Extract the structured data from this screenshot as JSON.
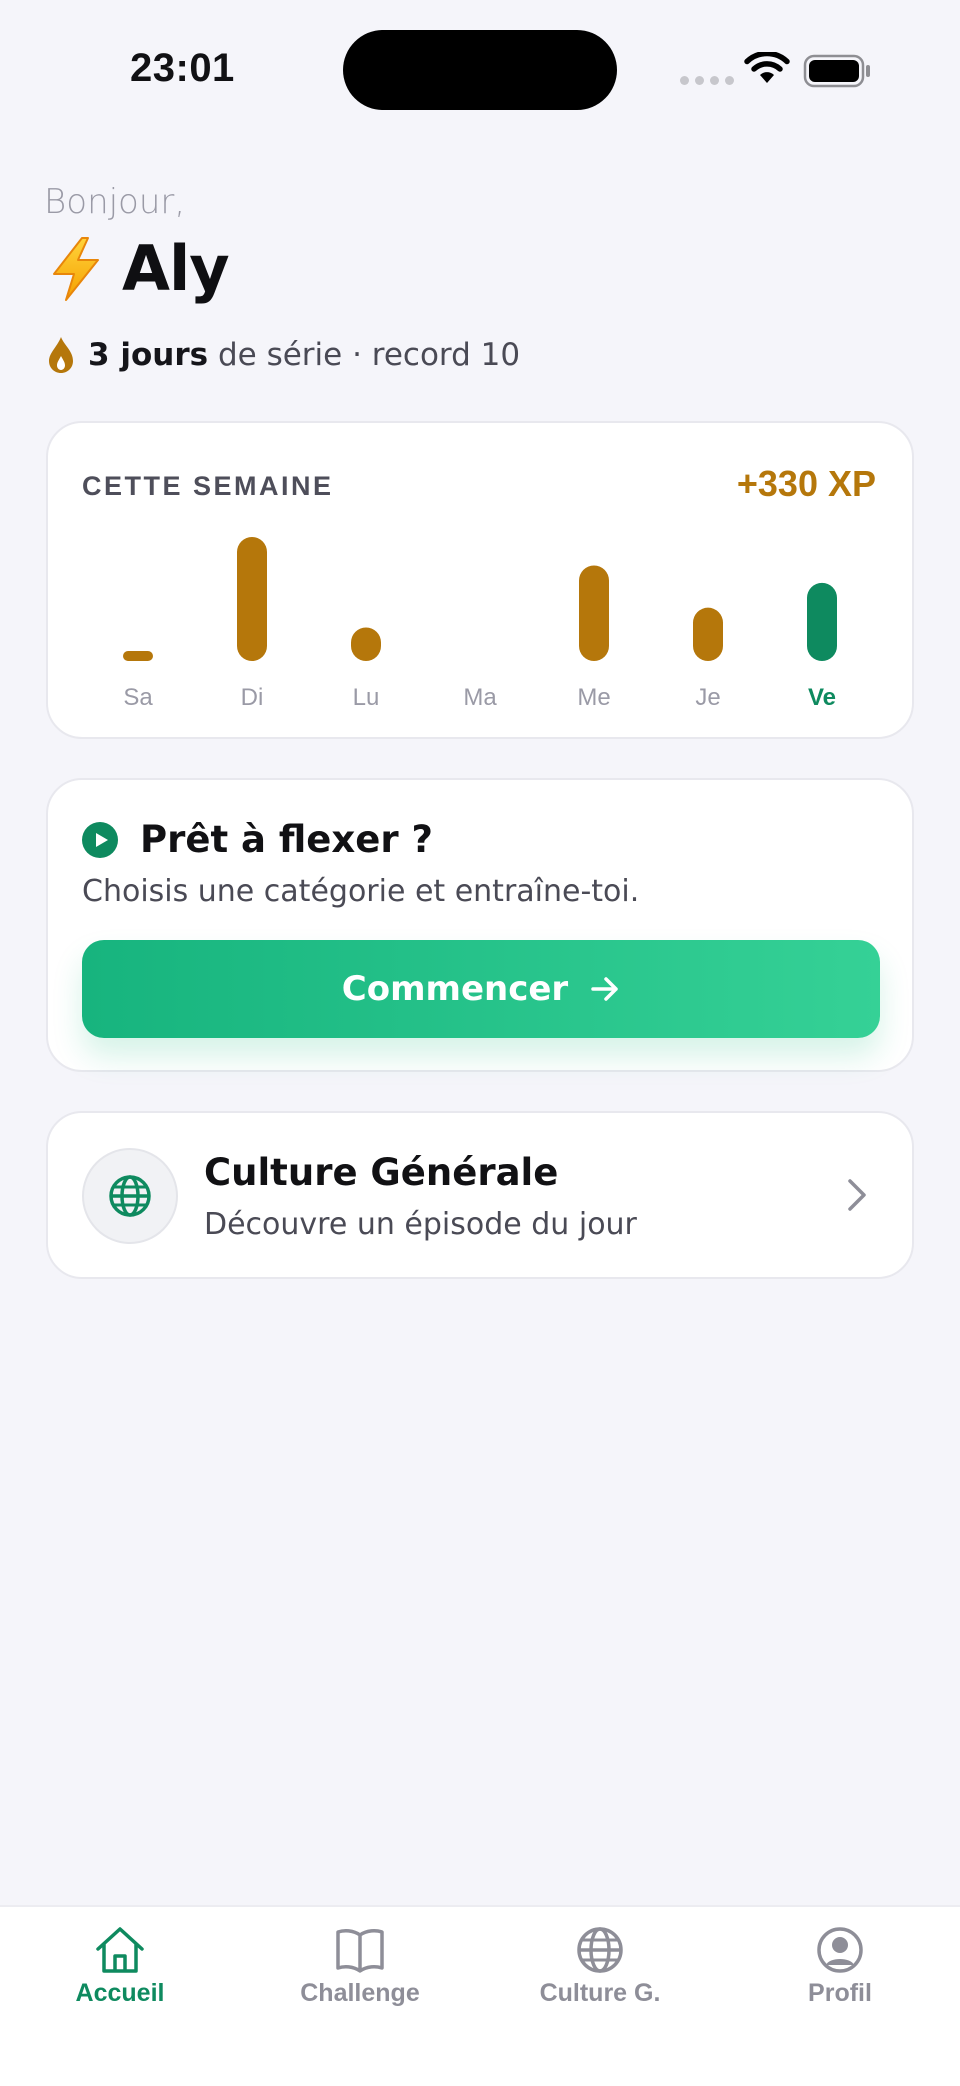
{
  "status_bar": {
    "time": "23:01"
  },
  "greeting": "Bonjour,",
  "user": {
    "emoji": "⚡",
    "name": "Aly"
  },
  "streak": {
    "strong": "3 jours",
    "rest": " de série · record 10"
  },
  "week": {
    "title": "CETTE SEMAINE",
    "xp": "+330 XP",
    "days": [
      {
        "label": "Sa",
        "level": 0.08
      },
      {
        "label": "Di",
        "level": 1.0
      },
      {
        "label": "Lu",
        "level": 0.27
      },
      {
        "label": "Ma",
        "level": 0
      },
      {
        "label": "Me",
        "level": 0.77
      },
      {
        "label": "Je",
        "level": 0.43
      },
      {
        "label": "Ve",
        "level": 0.63
      }
    ],
    "accent_color": "#b5770b",
    "today_color": "#0e8a5f"
  },
  "start": {
    "title": "Prêt à flexer ?",
    "subtitle": "Choisis une catégorie et entraîne-toi.",
    "button_label": "Commencer"
  },
  "culture": {
    "title": "Culture Générale",
    "subtitle": "Découvre un épisode du jour"
  },
  "tabs": [
    {
      "label": "Accueil",
      "icon": "home-icon",
      "active": true
    },
    {
      "label": "Challenge",
      "icon": "book-icon",
      "active": false
    },
    {
      "label": "Culture G.",
      "icon": "globe-icon",
      "active": false
    },
    {
      "label": "Profil",
      "icon": "profile-icon",
      "active": false
    }
  ]
}
